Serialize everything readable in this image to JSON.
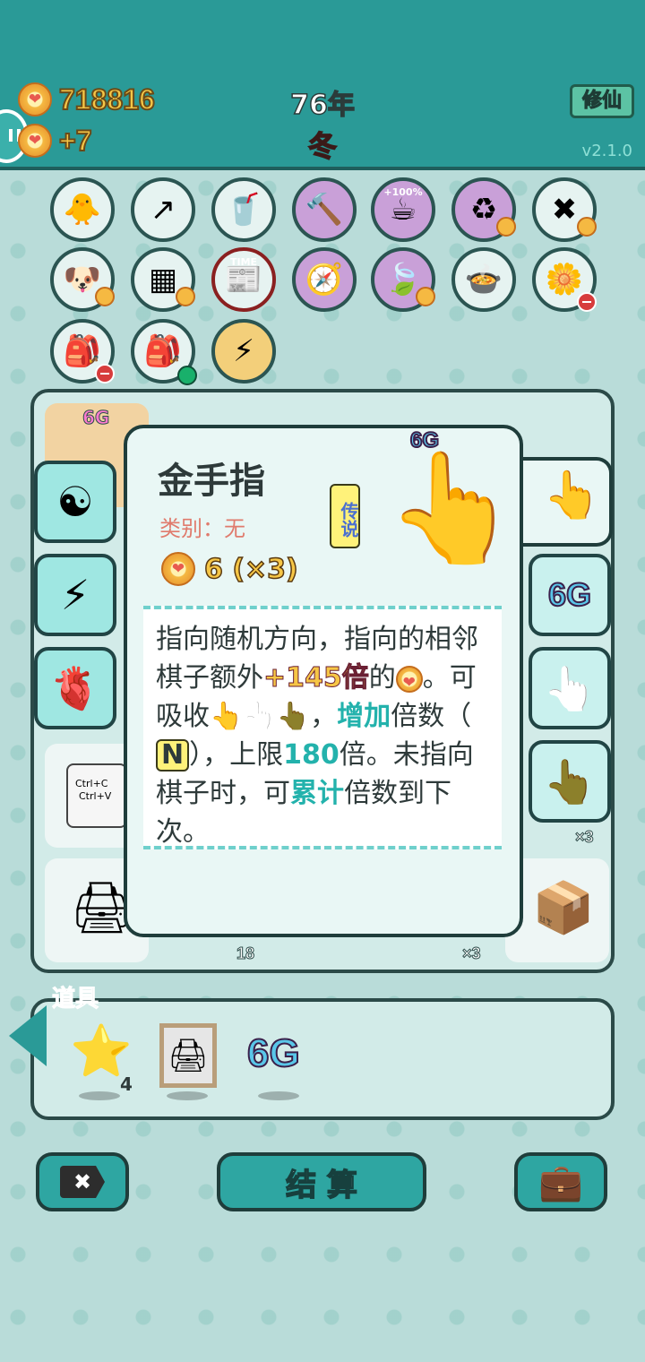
{
  "header": {
    "coins": "718816",
    "gain": "+7",
    "year": "76年",
    "season": "冬",
    "cultivate_button": "修仙",
    "version": "v2.1.0"
  },
  "relics": [
    {
      "icon": "chick-egg-icon",
      "glyph": "🐥"
    },
    {
      "icon": "arrow-up-icon",
      "glyph": "↗"
    },
    {
      "icon": "bubble-tea-icon",
      "glyph": "🥤"
    },
    {
      "icon": "hammer-icon",
      "glyph": "🔨"
    },
    {
      "icon": "cup-100-icon",
      "glyph": "☕",
      "label": "+100%"
    },
    {
      "icon": "recycle-icon",
      "glyph": "♻"
    },
    {
      "icon": "delete-tag-icon",
      "glyph": "✖"
    },
    {
      "icon": "dog-icon",
      "glyph": "🐶"
    },
    {
      "icon": "sugar-cubes-icon",
      "glyph": "▦"
    },
    {
      "icon": "time-magazine-icon",
      "glyph": "📰",
      "label": "TIME"
    },
    {
      "icon": "compass-icon",
      "glyph": "🧭"
    },
    {
      "icon": "leaf-icon",
      "glyph": "🍃"
    },
    {
      "icon": "duck-pot-icon",
      "glyph": "🍲"
    },
    {
      "icon": "flower-pot-icon",
      "glyph": "🌼"
    },
    {
      "icon": "bag-icon",
      "glyph": "🎒"
    },
    {
      "icon": "bag-icon",
      "glyph": "🎒"
    },
    {
      "icon": "lightning-icon",
      "glyph": "⚡"
    }
  ],
  "board": {
    "cells": [
      {
        "label": "6G"
      },
      {
        "label": "18"
      },
      {
        "label": "×3"
      },
      {
        "label": "×3"
      }
    ],
    "copy_paste": {
      "line1": "Ctrl+C",
      "line2": "Ctrl+V"
    }
  },
  "skills": [
    {
      "icon": "yin-yang-icon",
      "glyph": "☯"
    },
    {
      "icon": "lightning-icon",
      "glyph": "⚡"
    },
    {
      "icon": "liver-icon",
      "glyph": "🫀"
    }
  ],
  "right_buttons": [
    {
      "icon": "pointing-finger-yellow-icon",
      "glyph": "👆"
    },
    {
      "icon": "6g-icon",
      "label": "6G"
    },
    {
      "icon": "pointing-finger-white-icon",
      "glyph": "👆"
    },
    {
      "icon": "pointing-finger-brown-icon",
      "glyph": "👆"
    }
  ],
  "card": {
    "title": "金手指",
    "category": "类别：无",
    "rarity": "传说",
    "cost": "6 (×3)",
    "badge": "6G",
    "desc": {
      "p1": "指向随机方向，指向的相邻棋子额外",
      "bonus": "+145倍",
      "p2": "的",
      "p3": "。可吸收",
      "p4": "，",
      "increase": "增加",
      "p5": "倍数（",
      "n": "N",
      "p6": "），上限",
      "limit": "180",
      "p7": "倍。未指向棋子时，可",
      "accumulate": "累计",
      "p8": "倍数到下次。"
    }
  },
  "items": {
    "title": "道具",
    "list": [
      {
        "icon": "star-icon",
        "glyph": "⭐",
        "count": "4"
      },
      {
        "icon": "printer-icon",
        "glyph": "🖨"
      },
      {
        "icon": "6g-icon",
        "label": "6G"
      }
    ]
  },
  "buttons": {
    "delete": "✖",
    "settle": "结 算",
    "bag": "💼"
  },
  "colors": {
    "header": "#2a9a97",
    "background": "#b9dcd9",
    "accent_teal": "#23b2ac",
    "gold": "#f6c646"
  }
}
